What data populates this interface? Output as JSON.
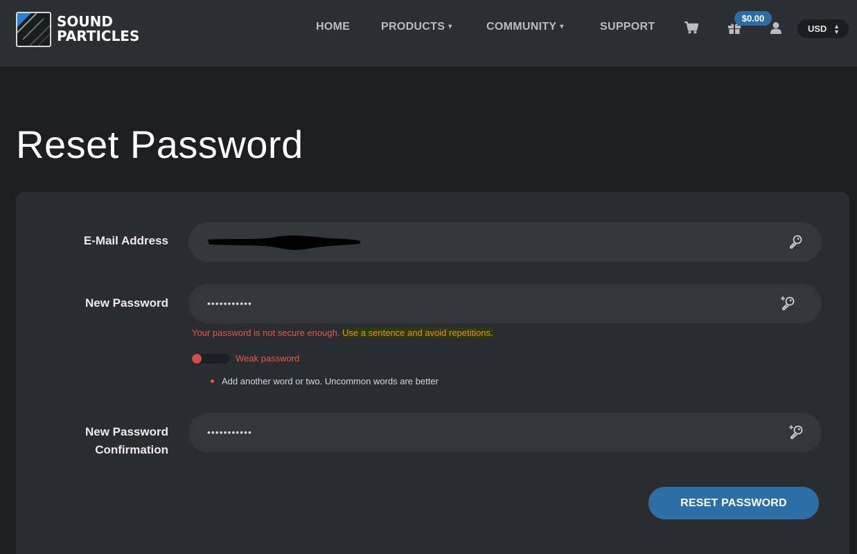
{
  "brand": {
    "line1": "Sound",
    "line2": "Particles",
    "logo_icon": "sound-particles-logo"
  },
  "nav": {
    "home": "HOME",
    "products": "PRODUCTS",
    "community": "COMMUNITY",
    "support": "SUPPORT",
    "caret": "▾"
  },
  "header_icons": {
    "cart": "cart-icon",
    "gift": "gift-icon",
    "user": "user-icon"
  },
  "cart_total": "$0.00",
  "currency": {
    "value": "USD",
    "icon": "sort-updown-icon"
  },
  "page": {
    "title": "Reset Password"
  },
  "form": {
    "email": {
      "label": "E-Mail Address",
      "icon": "key-icon"
    },
    "new_password": {
      "label": "New Password",
      "value": "•••••••••••",
      "icon": "key-plus-icon"
    },
    "confirm": {
      "label_line1": "New Password",
      "label_line2": "Confirmation",
      "value": "•••••••••••",
      "icon": "key-plus-icon"
    },
    "error_text_a": "Your password is not secure enough. ",
    "error_text_b": "Use a sentence and avoid repetitions.",
    "strength": {
      "label": "Weak password",
      "level": 0.25,
      "color": "#d24e4e"
    },
    "suggestion": "Add another word or two. Uncommon words are better",
    "submit": "RESET PASSWORD"
  },
  "colors": {
    "accent": "#2d6ea6",
    "error": "#e05a4d",
    "warning": "#ef8a2a"
  }
}
